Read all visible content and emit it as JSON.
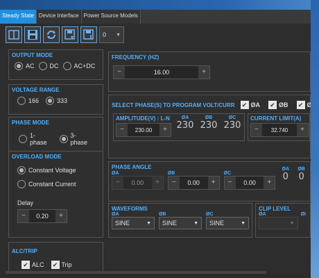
{
  "tabs": [
    {
      "label": "Steady State"
    },
    {
      "label": "Device Interface"
    },
    {
      "label": "Power Source Models"
    }
  ],
  "toolbar": {
    "select_value": "0"
  },
  "output_mode": {
    "title": "OUTPUT MODE",
    "options": [
      "AC",
      "DC",
      "AC+DC"
    ],
    "selected": "AC"
  },
  "voltage_range": {
    "title": "VOLTAGE RANGE",
    "options": [
      "166",
      "333"
    ],
    "selected": "333"
  },
  "phase_mode": {
    "title": "PHASE MODE",
    "options": [
      "1-phase",
      "3-phase"
    ],
    "selected": "3-phase"
  },
  "overload_mode": {
    "title": "OVERLOAD MODE",
    "options": [
      "Constant Voltage",
      "Constant Current"
    ],
    "selected": "Constant Voltage",
    "delay_label": "Delay",
    "delay_value": "0.20"
  },
  "alc_trip": {
    "title": "ALC/TRIP",
    "alc_label": "ALC",
    "trip_label": "Trip"
  },
  "frequency": {
    "title": "FREQUENCY (HZ)",
    "value": "16.00"
  },
  "select_phases": {
    "title": "SELECT PHASE(S) TO PROGRAM VOLT/CURR",
    "phases": [
      "ØA",
      "ØB",
      "ØC"
    ]
  },
  "amplitude": {
    "title": "AMPLITUDE(V) : L-N",
    "value": "230.00",
    "phase_labels": [
      "ØA",
      "ØB",
      "ØC"
    ],
    "phase_values": [
      "230",
      "230",
      "230"
    ]
  },
  "current_limit": {
    "title": "CURRENT LIMIT(A)",
    "value": "32.740"
  },
  "phase_angle": {
    "title": "PHASE ANGLE",
    "labels": [
      "ØA",
      "ØB",
      "ØC",
      "ØA",
      "ØB"
    ],
    "values": [
      "0.00",
      "0.00",
      "0.00"
    ],
    "readouts": [
      "0",
      "0"
    ]
  },
  "waveforms": {
    "title": "WAVEFORMS",
    "labels": [
      "ØA",
      "ØB",
      "ØC"
    ],
    "values": [
      "SINE",
      "SINE",
      "SINE"
    ]
  },
  "clip_level": {
    "title": "CLIP LEVEL",
    "labels": [
      "ØA",
      "ØI"
    ]
  },
  "colors": {
    "accent": "#1f8fe0",
    "label_blue": "#4fb0ff",
    "panel_bg": "#2f2f2f",
    "border": "#555555"
  },
  "icons": [
    "layout-icon",
    "save-icon",
    "refresh-icon",
    "save-as-icon",
    "save-download-icon"
  ]
}
